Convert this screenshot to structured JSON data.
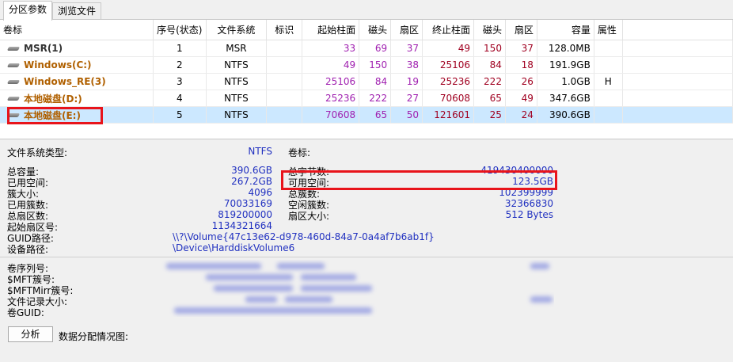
{
  "tabs": [
    "分区参数",
    "浏览文件"
  ],
  "columns": [
    "卷标",
    "序号(状态)",
    "文件系统",
    "标识",
    "起始柱面",
    "磁头",
    "扇区",
    "终止柱面",
    "磁头",
    "扇区",
    "容量",
    "属性"
  ],
  "partitions": [
    {
      "name": "MSR(1)",
      "index": "1",
      "fs": "MSR",
      "flag": "",
      "start_cyl": "33",
      "start_head": "69",
      "start_sec": "37",
      "end_cyl": "49",
      "end_head": "150",
      "end_sec": "37",
      "size": "128.0MB",
      "attr": ""
    },
    {
      "name": "Windows(C:)",
      "index": "2",
      "fs": "NTFS",
      "flag": "",
      "start_cyl": "49",
      "start_head": "150",
      "start_sec": "38",
      "end_cyl": "25106",
      "end_head": "84",
      "end_sec": "18",
      "size": "191.9GB",
      "attr": ""
    },
    {
      "name": "Windows_RE(3)",
      "index": "3",
      "fs": "NTFS",
      "flag": "",
      "start_cyl": "25106",
      "start_head": "84",
      "start_sec": "19",
      "end_cyl": "25236",
      "end_head": "222",
      "end_sec": "26",
      "size": "1.0GB",
      "attr": "H"
    },
    {
      "name": "本地磁盘(D:)",
      "index": "4",
      "fs": "NTFS",
      "flag": "",
      "start_cyl": "25236",
      "start_head": "222",
      "start_sec": "27",
      "end_cyl": "70608",
      "end_head": "65",
      "end_sec": "49",
      "size": "347.6GB",
      "attr": ""
    },
    {
      "name": "本地磁盘(E:)",
      "index": "5",
      "fs": "NTFS",
      "flag": "",
      "start_cyl": "70608",
      "start_head": "65",
      "start_sec": "50",
      "end_cyl": "121601",
      "end_head": "25",
      "end_sec": "24",
      "size": "390.6GB",
      "attr": ""
    }
  ],
  "info": {
    "fs_type_label": "文件系统类型:",
    "fs_type_value": "NTFS",
    "volume_label_label": "卷标:",
    "total_capacity_label": "总容量:",
    "total_capacity_value": "390.6GB",
    "used_space_label": "已用空间:",
    "used_space_value": "267.2GB",
    "cluster_size_label": "簇大小:",
    "cluster_size_value": "4096",
    "used_clusters_label": "已用簇数:",
    "used_clusters_value": "70033169",
    "total_sectors_label": "总扇区数:",
    "total_sectors_value": "819200000",
    "start_sector_label": "起始扇区号:",
    "start_sector_value": "1134321664",
    "guid_path_label": "GUID路径:",
    "guid_path_value": "\\\\?\\Volume{47c13e62-d978-460d-84a7-0a4af7b6ab1f}",
    "device_path_label": "设备路径:",
    "device_path_value": "\\Device\\HarddiskVolume6",
    "total_bytes_label": "总字节数:",
    "total_bytes_value": "419430400000",
    "free_space_label": "可用空间:",
    "free_space_value": "123.5GB",
    "total_clusters_label": "总簇数:",
    "total_clusters_value": "102399999",
    "free_clusters_label": "空闲簇数:",
    "free_clusters_value": "32366830",
    "sector_size_label": "扇区大小:",
    "sector_size_value": "512 Bytes",
    "serial_label": "卷序列号:",
    "mft_label": "$MFT簇号:",
    "mftmirr_label": "$MFTMirr簇号:",
    "record_size_label": "文件记录大小:",
    "volume_guid_label": "卷GUID:"
  },
  "analyze_button": "分析",
  "allocation_label": "数据分配情况图:"
}
